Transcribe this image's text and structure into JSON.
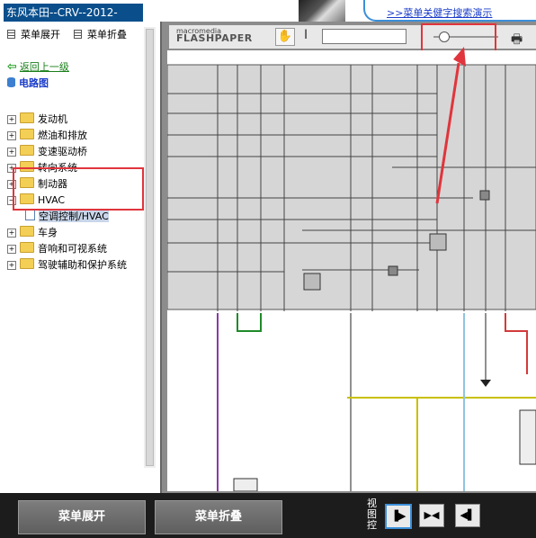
{
  "banner": {
    "search_tip": ">>菜单关健字搜索演示"
  },
  "left_panel": {
    "title": "东风本田--CRV--2012-",
    "expand_label": "菜单展开",
    "collapse_label": "菜单折叠",
    "back_label": "返回上一级",
    "root_label": "电路图",
    "tree": [
      {
        "label": "发动机",
        "state": "collapsed"
      },
      {
        "label": "燃油和排放",
        "state": "collapsed"
      },
      {
        "label": "变速驱动桥",
        "state": "collapsed"
      },
      {
        "label": "转向系统",
        "state": "collapsed"
      },
      {
        "label": "制动器",
        "state": "collapsed"
      },
      {
        "label": "HVAC",
        "state": "expanded"
      },
      {
        "label": "空调控制/HVAC",
        "state": "selected"
      },
      {
        "label": "车身",
        "state": "collapsed"
      },
      {
        "label": "音响和可视系统",
        "state": "collapsed"
      },
      {
        "label": "驾驶辅助和保护系统",
        "state": "collapsed"
      }
    ]
  },
  "viewer": {
    "logo_top": "macromedia",
    "logo_bottom": "FLASHPAPER",
    "search_value": "",
    "accent": "#e0353c"
  },
  "bottom": {
    "expand_label": "菜单展开",
    "collapse_label": "菜单折叠",
    "view_label": "视图控"
  },
  "colors": {
    "title_bar": "#0a4f8c",
    "highlight": "#e0353c",
    "toolbar_bg": "#e8e8e8",
    "bottom_bg": "#1c1c1c"
  }
}
